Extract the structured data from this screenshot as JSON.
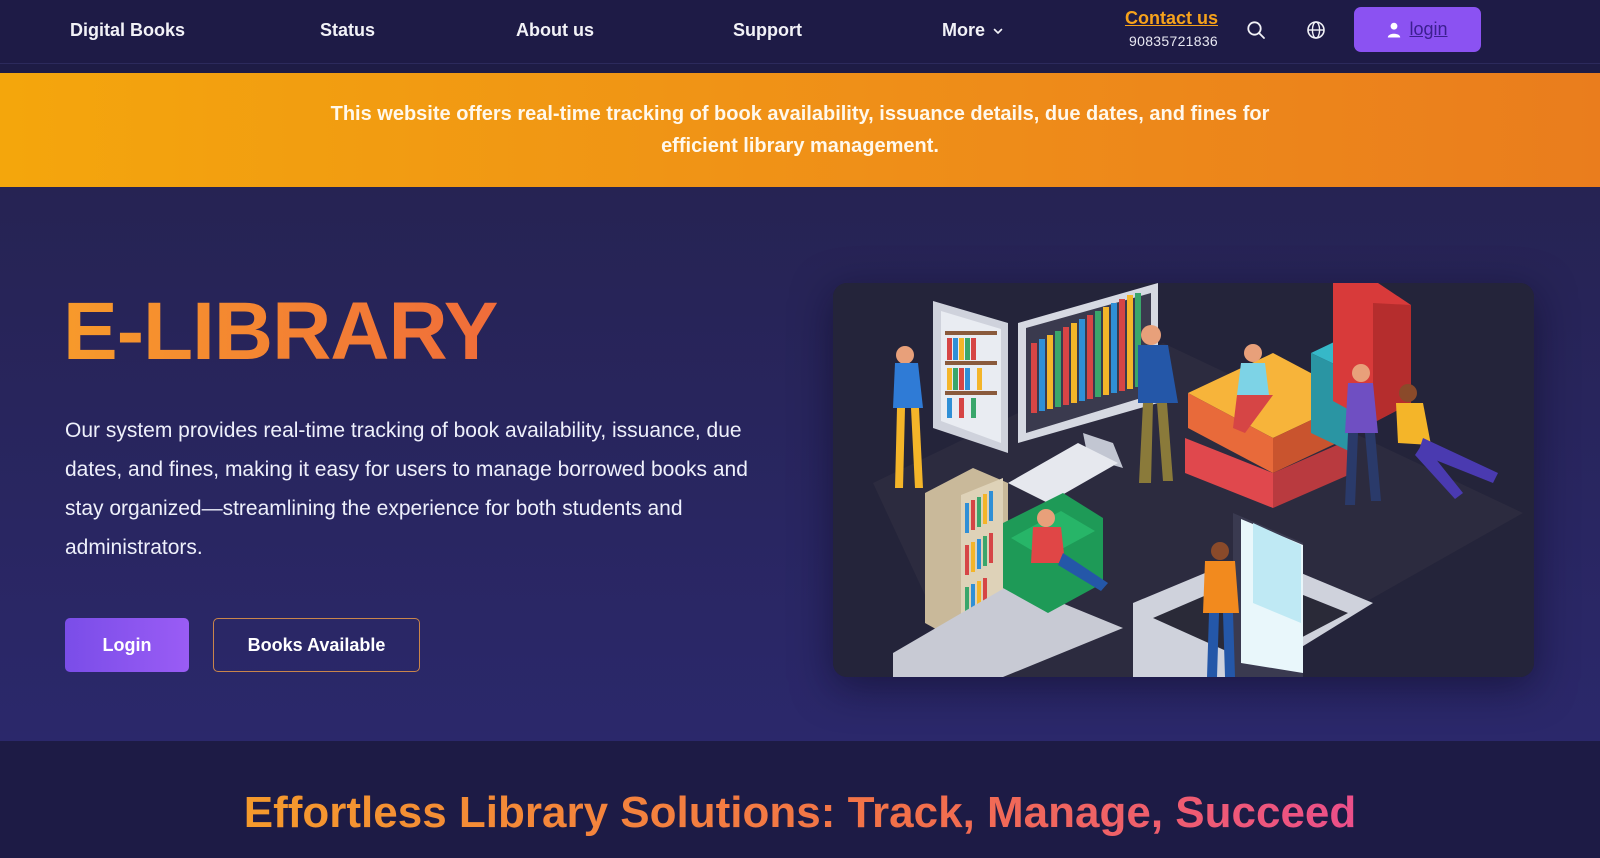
{
  "nav": {
    "brand": "Digital Books",
    "links": [
      "Status",
      "About us",
      "Support"
    ],
    "more_label": "More",
    "contact_label": "Contact us",
    "contact_phone": "90835721836",
    "login_label": "login"
  },
  "banner": {
    "text": "This website offers real-time tracking of book availability, issuance details, due dates, and fines for efficient library management."
  },
  "hero": {
    "title": "E-LIBRARY",
    "description": "Our system provides real-time tracking of book availability, issuance, due dates, and fines, making it easy for users to manage borrowed books and stay organized—streamlining the experience for both students and administrators.",
    "login_button": "Login",
    "books_button": "Books Available"
  },
  "features": {
    "heading": "Effortless Library Solutions: Track, Manage, Succeed"
  },
  "colors": {
    "nav_bg": "#1e1b46",
    "accent_purple": "#8b52f2",
    "accent_orange": "#f6a21b",
    "hero_bg": "#2b286b"
  },
  "icons": {
    "search": "search-icon",
    "language": "globe-icon",
    "user": "user-icon",
    "more": "chevron-down-icon"
  }
}
